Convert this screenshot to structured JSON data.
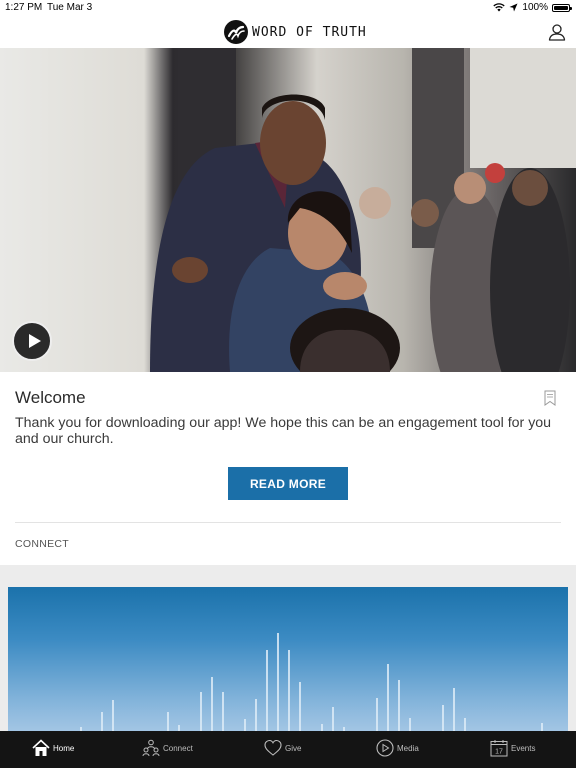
{
  "status_bar": {
    "time": "1:27 PM",
    "date": "Tue Mar 3",
    "battery": "100%"
  },
  "header": {
    "logo_text": "WORD OF TRUTH",
    "profile_icon": "person-icon"
  },
  "hero": {
    "play_icon": "play-icon"
  },
  "welcome_card": {
    "title": "Welcome",
    "body": "Thank you for downloading our app! We hope this can be an engagement tool for you and our church.",
    "button_label": "READ MORE",
    "section_label": "CONNECT",
    "bookmark_icon": "bookmark-icon"
  },
  "tab_bar": {
    "items": [
      {
        "label": "Home",
        "icon": "home-icon"
      },
      {
        "label": "Connect",
        "icon": "people-icon"
      },
      {
        "label": "Give",
        "icon": "heart-icon"
      },
      {
        "label": "Media",
        "icon": "play-circle-icon"
      },
      {
        "label": "Events",
        "icon": "calendar-icon",
        "day": "17"
      }
    ]
  },
  "colors": {
    "accent": "#1b6fa8",
    "tab_bar_bg": "#141414"
  }
}
